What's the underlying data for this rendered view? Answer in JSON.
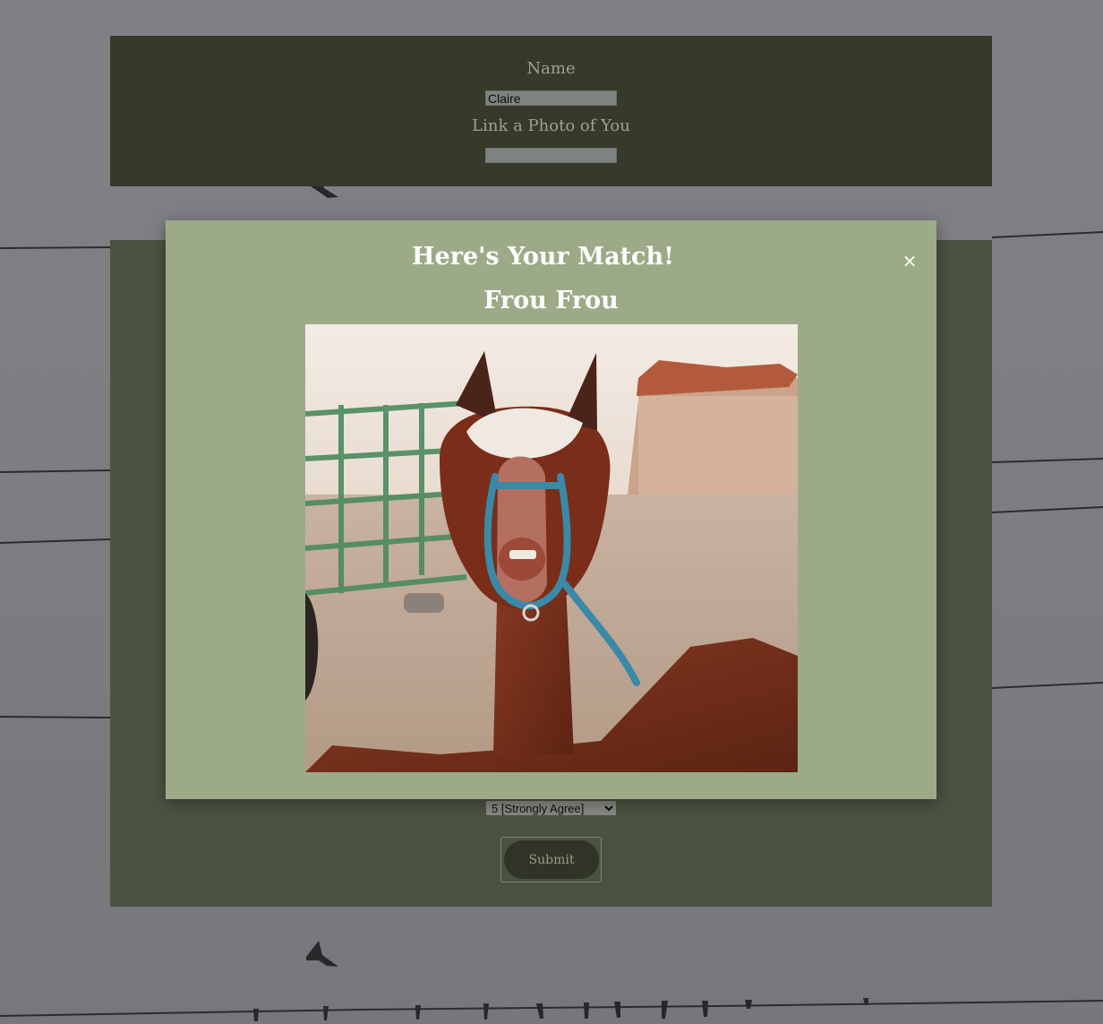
{
  "form": {
    "name_label": "Name",
    "name_value": "Claire",
    "photo_label": "Link a Photo of You",
    "photo_value": "",
    "answer_selected": "5 [Strongly Agree]",
    "submit_label": "Submit"
  },
  "modal": {
    "title": "Here's Your Match!",
    "close_glyph": "×",
    "match_name": "Frou Frou",
    "photo_icon": "alpaca-photo"
  },
  "colors": {
    "modal_background": "#9daa87",
    "name_panel": "#363a2b",
    "questions_panel": "#4b5242",
    "submit_button": "#2f3427",
    "submit_border": "#758f6c"
  }
}
